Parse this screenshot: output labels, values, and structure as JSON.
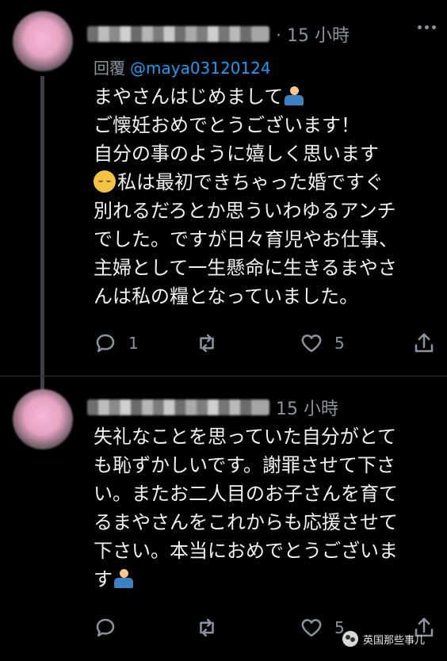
{
  "tweets": [
    {
      "time": "· 15 小時",
      "reply_label": "回覆",
      "reply_handle": "@maya03120124",
      "lines": [
        "まやさんはじめまして",
        "ご懐妊おめでとうございます！",
        "自分の事のように嬉しく思います",
        "私は最初できちゃった婚ですぐ",
        "別れるだろとか思ういわゆるアンチ",
        "でした。ですが日々育児やお仕事、",
        "主婦として一生懸命に生きるまやさ",
        "んは私の糧となっていました。"
      ],
      "reply_count": "1",
      "retweet_count": "",
      "like_count": "5"
    },
    {
      "time": "15 小時",
      "lines": [
        "失礼なことを思っていた自分がとて",
        "も恥ずかしいです。謝罪させて下さ",
        "い。またお二人目のお子さんを育て",
        "るまやさんをこれからも応援させて",
        "下さい。本当におめでとうございま",
        "す"
      ],
      "reply_count": "",
      "retweet_count": "",
      "like_count": "5"
    }
  ],
  "icons": {
    "reply": "comment-bubble-icon",
    "retweet": "retweet-icon",
    "like": "heart-icon",
    "share": "share-icon",
    "emoji_person": "person-bowing-emoji",
    "emoji_relieved": "relieved-face-emoji"
  },
  "watermark": {
    "text": "英国那些事儿"
  },
  "colors": {
    "background": "#000000",
    "text": "#f2f2f2",
    "muted": "#8b949e",
    "link": "#1d9bf0"
  }
}
